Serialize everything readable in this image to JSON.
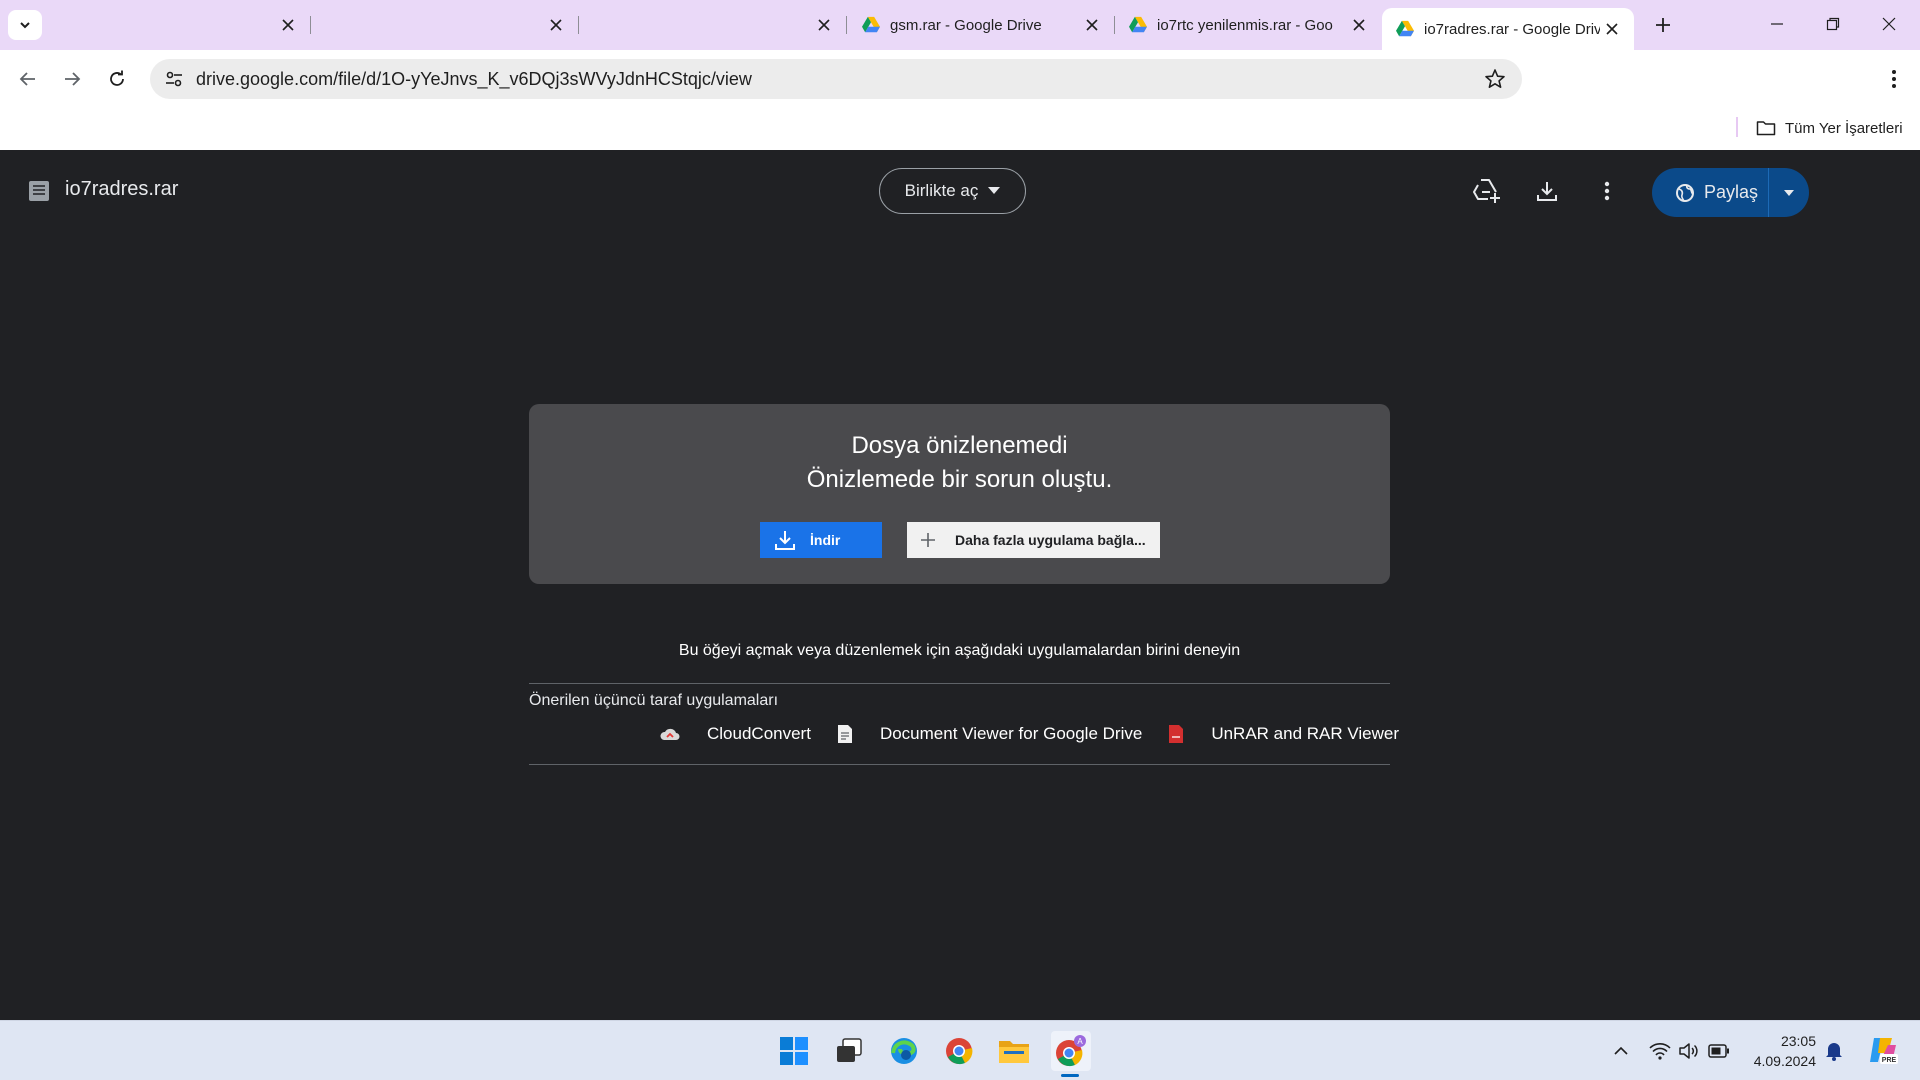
{
  "tabs": [
    {
      "title": "",
      "favicon": "none",
      "active": false
    },
    {
      "title": "",
      "favicon": "none",
      "active": false
    },
    {
      "title": "",
      "favicon": "none",
      "active": false
    },
    {
      "title": "gsm.rar - Google Drive",
      "favicon": "google-drive-icon",
      "active": false
    },
    {
      "title": "io7rtc yenilenmis.rar - Goo",
      "favicon": "google-drive-icon",
      "active": false
    },
    {
      "title": "io7radres.rar - Google Driv",
      "favicon": "google-drive-icon",
      "active": true
    }
  ],
  "toolbar": {
    "url": "drive.google.com/file/d/1O-yYeJnvs_K_v6DQj3sWVyJdnHCStqjc/view"
  },
  "bookmarks": {
    "all_label": "Tüm Yer İşaretleri"
  },
  "viewer": {
    "file_name": "io7radres.rar",
    "open_with_label": "Birlikte aç",
    "share_label": "Paylaş",
    "error_title": "Dosya önizlenemedi",
    "error_subtitle": "Önizlemede bir sorun oluştu.",
    "download_label": "İndir",
    "connect_more_label": "Daha fazla uygulama bağla...",
    "try_apps_text": "Bu öğeyi açmak veya düzenlemek için aşağıdaki uygulamalardan birini deneyin",
    "suggested_label": "Önerilen üçüncü taraf uygulamaları",
    "apps": [
      {
        "name": "CloudConvert",
        "icon": "cloudconvert-icon"
      },
      {
        "name": "Document Viewer for Google Drive",
        "icon": "document-viewer-icon"
      },
      {
        "name": "UnRAR and RAR Viewer",
        "icon": "unrar-icon"
      }
    ]
  },
  "taskbar": {
    "time": "23:05",
    "date": "4.09.2024",
    "icons": [
      "windows-start-icon",
      "task-view-icon",
      "edge-icon",
      "chrome-icon",
      "file-explorer-icon",
      "chrome-profile-icon"
    ]
  },
  "colors": {
    "tabstrip": "#ead9f8",
    "viewer_bg": "#202124",
    "card_bg": "#4a4a4d",
    "download_button": "#1a73e8",
    "share_button": "#0b4a8a"
  }
}
